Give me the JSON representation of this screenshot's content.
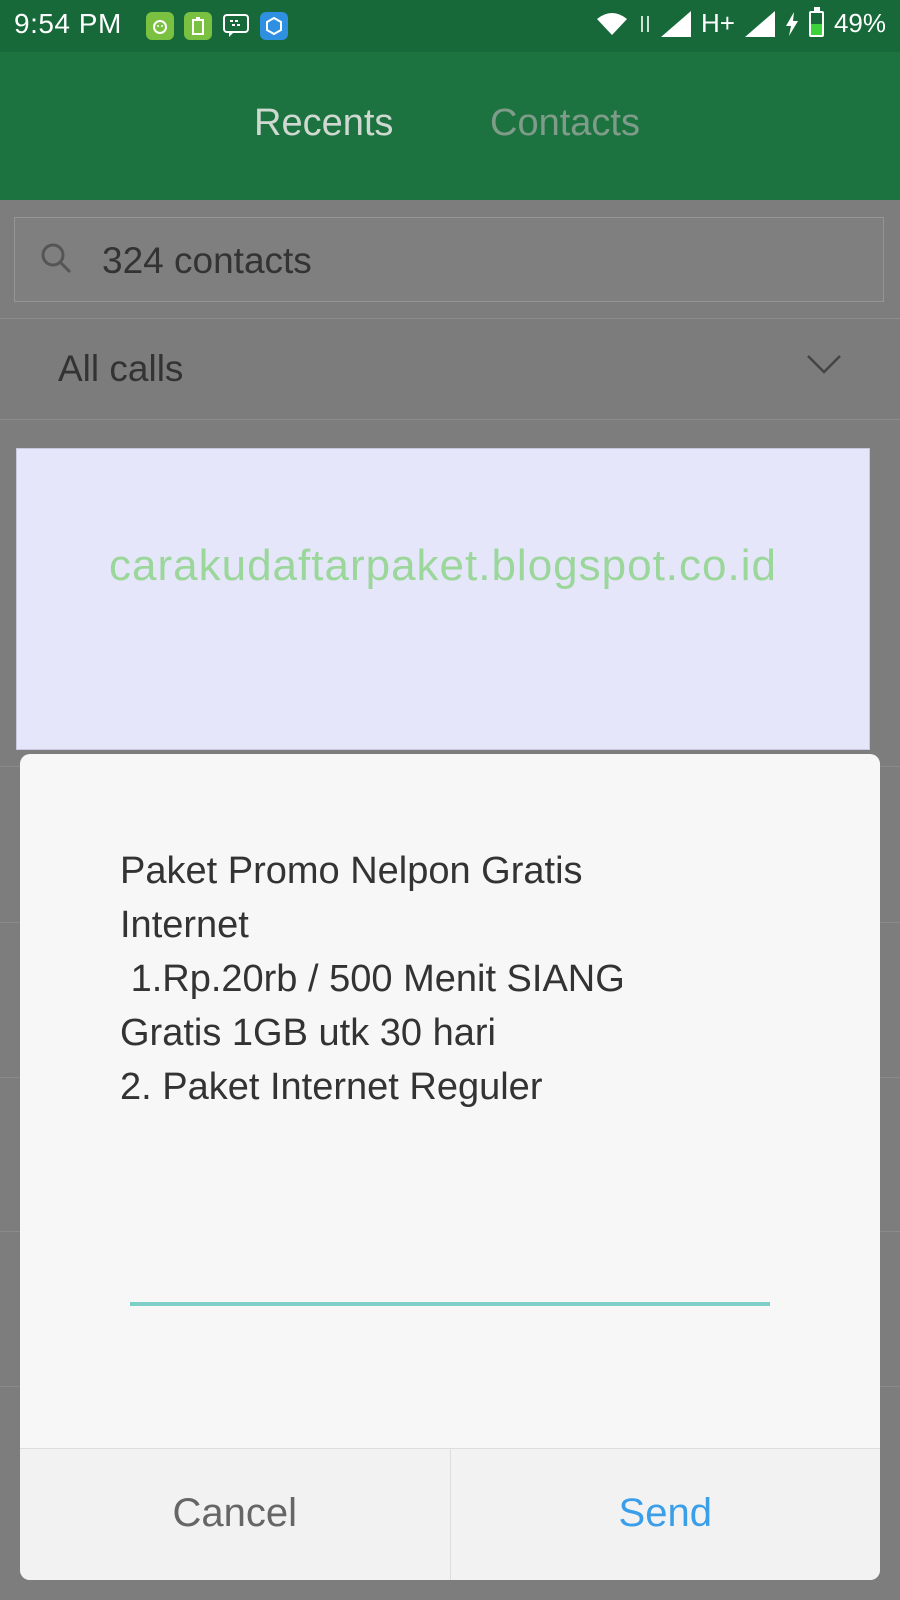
{
  "status_bar": {
    "time": "9:54 PM",
    "network": "H+",
    "battery": "49%",
    "battery_level": 0.49,
    "notification_icons": [
      "android-icon",
      "battery-app-icon",
      "bbm-icon",
      "mi-icon"
    ]
  },
  "tabs": [
    {
      "label": "Recents",
      "active": true
    },
    {
      "label": "Contacts",
      "active": false
    }
  ],
  "search": {
    "placeholder": "324 contacts"
  },
  "filter": {
    "label": "All calls"
  },
  "watermark": {
    "text": "carakudaftarpaket.blogspot.co.id"
  },
  "dialog": {
    "message": "Paket Promo Nelpon Gratis\nInternet\n 1.Rp.20rb / 500 Menit SIANG\nGratis 1GB utk 30 hari\n2. Paket Internet Reguler",
    "input_value": "",
    "cancel_label": "Cancel",
    "send_label": "Send"
  },
  "colors": {
    "header": "#1d7340",
    "accent": "#3a9ee8",
    "input_underline": "#7ecfc7"
  }
}
